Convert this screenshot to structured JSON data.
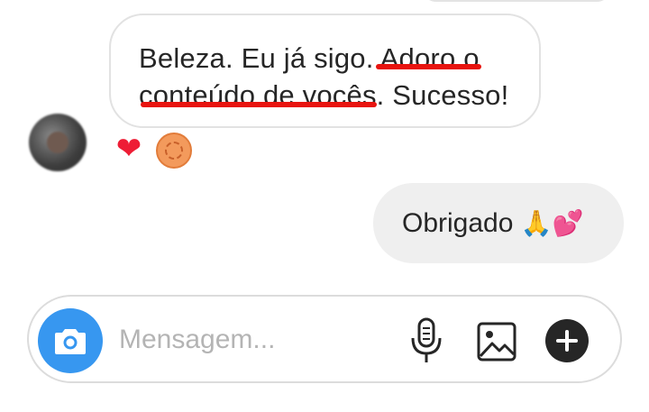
{
  "conversation": {
    "incoming_message": {
      "text_before": "Beleza. Eu já sigo. ",
      "highlight_1": "Adoro o",
      "line2_highlight": "conteúdo de vocês",
      "text_after": ". Sucesso!"
    },
    "reactions": [
      {
        "icon": "heart-icon",
        "color": "#ee1d35"
      },
      {
        "icon": "reactor-avatar-icon",
        "color": "#f39a5c"
      }
    ],
    "outgoing_message": {
      "text": "Obrigado",
      "emoji": "🙏💕"
    },
    "highlight_color": "#e8140f"
  },
  "composer": {
    "placeholder": "Mensagem...",
    "value": "",
    "accent": "#3797f0",
    "icons": [
      "camera-icon",
      "microphone-icon",
      "gallery-icon",
      "plus-icon"
    ]
  }
}
